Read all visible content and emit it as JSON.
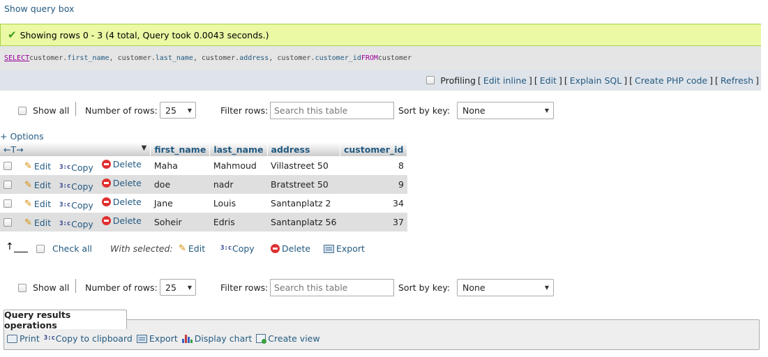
{
  "top": {
    "show_query_box": "Show query box"
  },
  "success": {
    "message": "Showing rows 0 - 3 (4 total, Query took 0.0043 seconds.)"
  },
  "sql": {
    "select_kw": "SELECT",
    "f1_tbl": " customer.",
    "f1": "first_name",
    "f2_tbl": ", customer.",
    "f2": "last_name",
    "f3_tbl": ", customer.",
    "f3": "address",
    "f4_tbl": ", customer.",
    "f4": "customer_id",
    "from_kw": " FROM",
    "table": " customer"
  },
  "profiling": {
    "label": "Profiling",
    "edit_inline": "Edit inline",
    "edit": "Edit",
    "explain": "Explain SQL",
    "php": "Create PHP code",
    "refresh": "Refresh"
  },
  "nav": {
    "show_all": "Show all",
    "num_rows_label": "Number of rows:",
    "num_rows_value": "25",
    "filter_label": "Filter rows:",
    "filter_placeholder": "Search this table",
    "sort_label": "Sort by key:",
    "sort_value": "None"
  },
  "options_label": "+ Options",
  "table": {
    "columns": [
      "first_name",
      "last_name",
      "address",
      "customer_id"
    ],
    "actions": {
      "edit": "Edit",
      "copy": "Copy",
      "delete": "Delete"
    },
    "rows": [
      {
        "first_name": "Maha",
        "last_name": "Mahmoud",
        "address": "Villastreet 50",
        "customer_id": "8"
      },
      {
        "first_name": "doe",
        "last_name": "nadr",
        "address": "Bratstreet 50",
        "customer_id": "9"
      },
      {
        "first_name": "Jane",
        "last_name": "Louis",
        "address": "Santanplatz 2",
        "customer_id": "34"
      },
      {
        "first_name": "Soheir",
        "last_name": "Edris",
        "address": "Santanplatz 56",
        "customer_id": "37"
      }
    ]
  },
  "bulk": {
    "check_all": "Check all",
    "with_selected": "With selected:",
    "edit": "Edit",
    "copy": "Copy",
    "delete": "Delete",
    "export": "Export"
  },
  "ops": {
    "title": "Query results operations",
    "print": "Print",
    "copy_clipboard": "Copy to clipboard",
    "export": "Export",
    "display_chart": "Display chart",
    "create_view": "Create view"
  },
  "colors": {
    "success_bg": "#ebf8a4",
    "link": "#235a81",
    "sql_bg": "#e5e5e5",
    "profiling_bg": "#dfe4ea"
  }
}
